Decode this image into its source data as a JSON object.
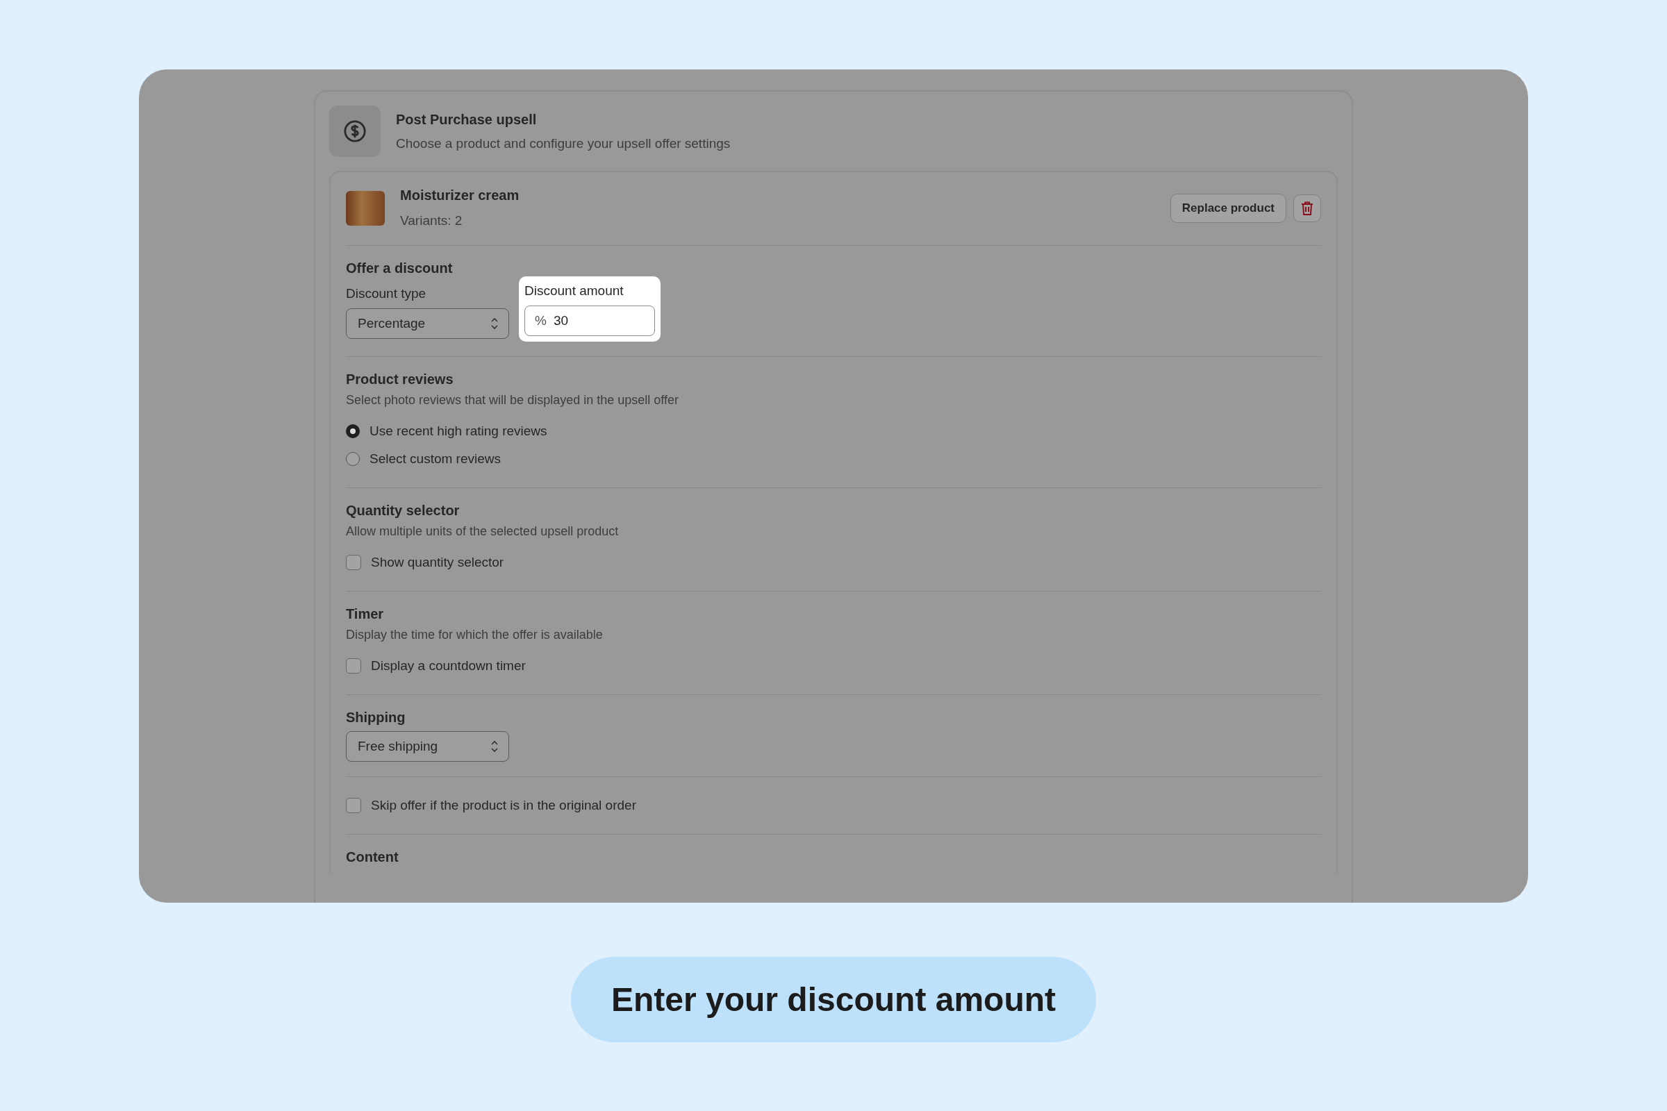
{
  "header": {
    "title": "Post Purchase upsell",
    "subtitle": "Choose a product and configure your upsell offer settings"
  },
  "product": {
    "name": "Moisturizer cream",
    "variants": "Variants: 2",
    "replace_button": "Replace product"
  },
  "discount": {
    "heading": "Offer a discount",
    "type_label": "Discount type",
    "type_value": "Percentage",
    "amount_label": "Discount amount",
    "amount_prefix": "%",
    "amount_value": "30",
    "highlighted": true
  },
  "sections": [
    {
      "kind": "radio",
      "heading": "Product reviews",
      "description": "Select photo reviews that will be displayed in the upsell offer",
      "options": [
        {
          "label": "Use recent high rating reviews",
          "selected": true
        },
        {
          "label": "Select custom reviews",
          "selected": false
        }
      ]
    },
    {
      "kind": "checkbox",
      "heading": "Quantity selector",
      "description": "Allow multiple units of the selected upsell product",
      "options": [
        {
          "label": "Show quantity selector",
          "checked": false
        }
      ]
    },
    {
      "kind": "checkbox",
      "heading": "Timer",
      "description": "Display the time for which the offer is available",
      "options": [
        {
          "label": "Display a countdown timer",
          "checked": false
        }
      ]
    },
    {
      "kind": "select",
      "heading": "Shipping",
      "value": "Free shipping"
    },
    {
      "kind": "checkbox",
      "options": [
        {
          "label": "Skip offer if the product is in the original order",
          "checked": false
        }
      ]
    },
    {
      "kind": "heading",
      "heading": "Content"
    }
  ],
  "caption": "Enter your discount amount"
}
